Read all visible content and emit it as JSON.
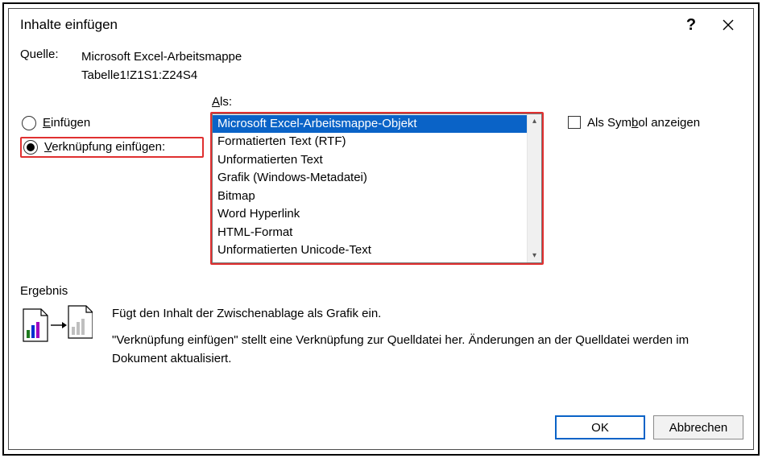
{
  "title": "Inhalte einfügen",
  "source": {
    "label": "Quelle:",
    "line1": "Microsoft Excel-Arbeitsmappe",
    "line2": "Tabelle1!Z1S1:Z24S4"
  },
  "paste_mode": {
    "insert": {
      "prefix": "E",
      "rest": "infügen",
      "checked": false
    },
    "link": {
      "prefix": "V",
      "rest": "erknüpfung einfügen:",
      "checked": true
    }
  },
  "as_label": {
    "prefix": "A",
    "rest": "ls:"
  },
  "as_list": {
    "selected_index": 0,
    "items": [
      "Microsoft Excel-Arbeitsmappe-Objekt",
      "Formatierten Text (RTF)",
      "Unformatierten Text",
      "Grafik (Windows-Metadatei)",
      "Bitmap",
      "Word Hyperlink",
      "HTML-Format",
      "Unformatierten Unicode-Text"
    ]
  },
  "show_as_icon": {
    "text_pre": "Als Sym",
    "u": "b",
    "text_post": "ol anzeigen",
    "checked": false
  },
  "result": {
    "title": "Ergebnis",
    "p1": "Fügt den Inhalt der Zwischenablage als Grafik ein.",
    "p2": "\"Verknüpfung einfügen\" stellt eine Verknüpfung zur Quelldatei her. Änderungen an der Quelldatei werden im Dokument aktualisiert."
  },
  "buttons": {
    "ok": "OK",
    "cancel": "Abbrechen"
  }
}
